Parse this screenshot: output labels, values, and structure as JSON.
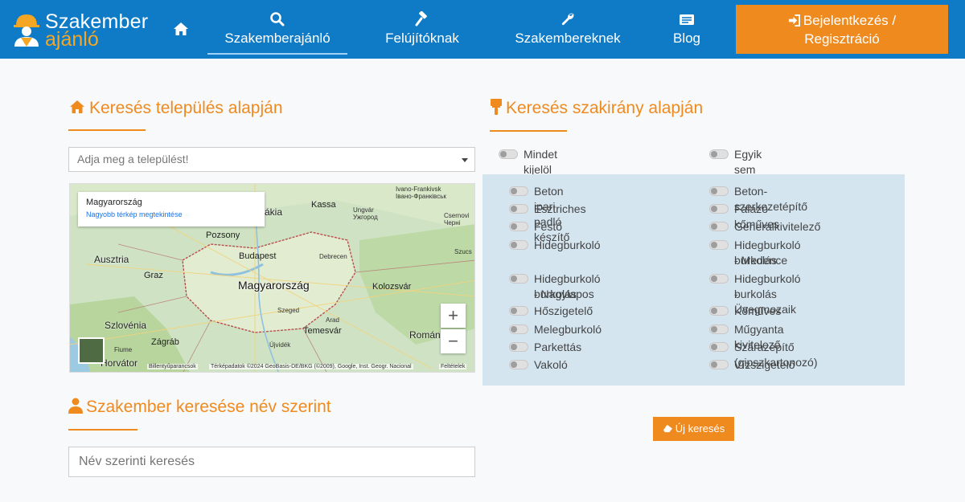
{
  "brand": {
    "line1": "Szakember",
    "line2": "ajánló"
  },
  "nav": {
    "kereso": "Szakemberajánló",
    "felujitoknak": "Felújítóknak",
    "szakembereknek": "Szakembereknek",
    "blog": "Blog",
    "login_line1": "Bejelentkezés /",
    "login_line2": "Regisztráció"
  },
  "location_section": {
    "title": "Keresés település alapján",
    "select_placeholder": "Adja meg a települést!"
  },
  "map": {
    "info_title": "Magyarország",
    "info_link": "Nagyobb térkép megtekintése",
    "labels": {
      "ivano": "Ivano-Frankivsk",
      "ivano_cyr": "Івано-Франківськ",
      "vakia": "vákia",
      "kassa": "Kassa",
      "uzhorod": "Ungvár",
      "uzhorod_cyr": "Ужгород",
      "czernow": "Csernovi",
      "czernow2": "Черні",
      "pozsony": "Pozsony",
      "ausztria": "Ausztria",
      "budapest": "Budapest",
      "debrecen": "Debrecen",
      "szucs": "Szucs",
      "graz": "Graz",
      "magyarorszag": "Magyarország",
      "kolozsvar": "Kolozsvár",
      "szeged": "Szeged",
      "szlovenia": "Szlovénia",
      "arad": "Arad",
      "temesvar": "Temesvár",
      "romania": "Román",
      "zagrab": "Zágráb",
      "fiume": "Fiume",
      "horvat": "Horvátor",
      "ujvidek": "Újvidék",
      "bosznia": "B..."
    },
    "zoom_in": "+",
    "zoom_out": "−",
    "footer_shortcuts": "Billentyűparancsok",
    "footer_data": "Térképadatok ©2024 GeoBasis-DE/BKG (©2009), Google, Inst. Geogr. Nacional",
    "footer_terms": "Feltételek"
  },
  "name_section": {
    "title": "Szakember keresése név szerint",
    "placeholder": "Név szerinti keresés"
  },
  "category_section": {
    "title": "Keresés szakirány alapján",
    "select_all": "Mindet kijelöl",
    "select_none": "Egyik sem",
    "left_items": [
      {
        "line1": "Beton ipari padló készítő"
      },
      {
        "line1": "Esztriches"
      },
      {
        "line1": "Festő"
      },
      {
        "line1": "Hidegburkoló"
      },
      {
        "line1": "Hidegburkoló - Nagylapos",
        "line2": "burkolás"
      },
      {
        "line1": "Hőszigetelő"
      },
      {
        "line1": "Melegburkoló"
      },
      {
        "line1": "Parkettás"
      },
      {
        "line1": "Vakoló"
      }
    ],
    "right_items": [
      {
        "line1": "Beton-szerkezetépítő"
      },
      {
        "line1": "Falazó kőműves"
      },
      {
        "line1": "Generálkivitelező"
      },
      {
        "line1": "Hidegburkoló - Medence",
        "line2": "burkolás"
      },
      {
        "line1": "Hidegburkoló - Üvegmozaik",
        "line2": "burkolás"
      },
      {
        "line1": "Kőműves"
      },
      {
        "line1": "Műgyanta kivitelező"
      },
      {
        "line1": "Szárazépítő (gipszkartonozó)"
      },
      {
        "line1": "Vízszigetelő"
      }
    ],
    "new_search": "Új keresés"
  },
  "colors": {
    "nav_blue": "#0f7bc6",
    "accent_orange": "#ef8a1f",
    "panel_blue": "#d4e5f0"
  }
}
